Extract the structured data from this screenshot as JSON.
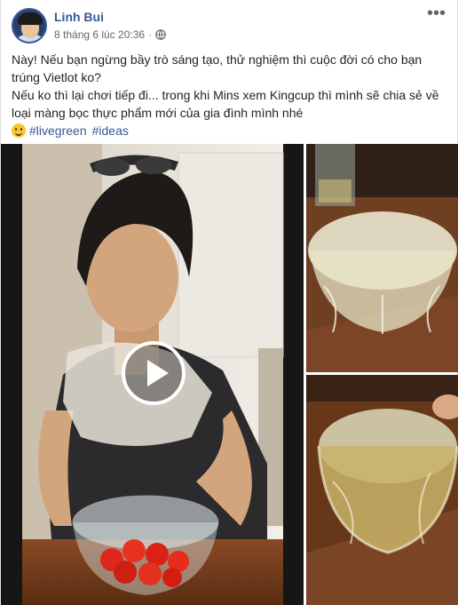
{
  "post": {
    "author": "Linh Bui",
    "timestamp": "8 tháng 6 lúc 20:36",
    "privacy_icon": "globe-icon",
    "more_icon": "more-dots-icon",
    "more_label": "•••",
    "lines": [
      "Này! Nếu bạn ngừng bầy trò sáng tạo, thử nghiệm thì cuộc đời có cho bạn trúng Vietlot ko?",
      "Nếu ko thì lại chơi tiếp đi... trong khi Mins xem Kingcup thì mình sẽ chia sẻ về loại màng bọc thực phẩm mới của gia đình mình nhé"
    ],
    "emoji_icon": "smiley-icon",
    "hashtags": [
      "#livegreen",
      "#ideas"
    ]
  },
  "media": {
    "video_icon": "play-icon",
    "photos": [
      "video-thumbnail",
      "bowl-photo-top",
      "bowl-photo-bottom"
    ]
  },
  "colors": {
    "link": "#365899",
    "text": "#1d2129",
    "meta": "#616770"
  }
}
